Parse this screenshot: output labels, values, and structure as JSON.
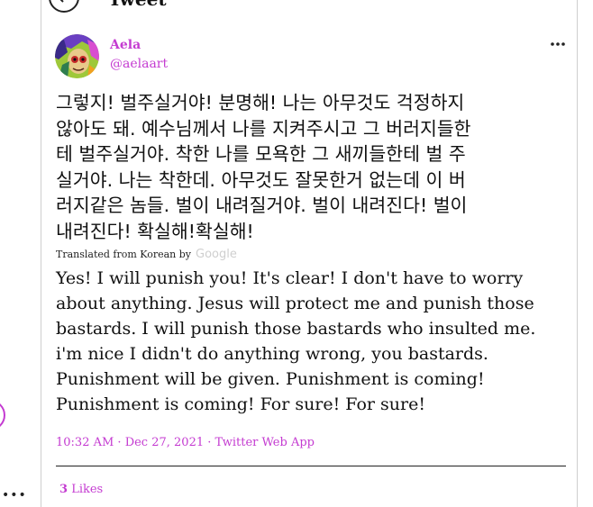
{
  "header": {
    "title": "Tweet"
  },
  "tweet": {
    "display_name": "Aela",
    "handle": "@aelaart",
    "korean_text": "그렇지! 벌주실거야! 분명해! 나는 아무것도 걱정하지\n않아도 돼. 예수님께서 나를 지켜주시고 그 버러지들한\n테 벌주실거야. 착한 나를 모욕한 그 새끼들한테 벌 주\n실거야. 나는 착한데. 아무것도 잘못한거 없는데 이 버\n러지같은 놈들. 벌이 내려질거야. 벌이 내려진다! 벌이\n내려진다! 확실해!확실해!",
    "translated_from": "Translated from Korean by",
    "translation_brand": "Google",
    "english_text": "Yes! I will punish you! It's clear! I don't have to worry about anything. Jesus will protect me and punish those bastards. I will punish those bastards who insulted me. i'm nice I didn't do anything wrong, you bastards. Punishment will be given. Punishment is coming! Punishment is coming! For sure! For sure!",
    "timestamp": "10:32 AM · Dec 27, 2021 · Twitter Web App",
    "likes_count": "3",
    "likes_label": "Likes"
  },
  "colors": {
    "accent": "#c43bd1"
  },
  "icons": {
    "back": "back-arrow-icon",
    "more": "more-dots-icon"
  }
}
